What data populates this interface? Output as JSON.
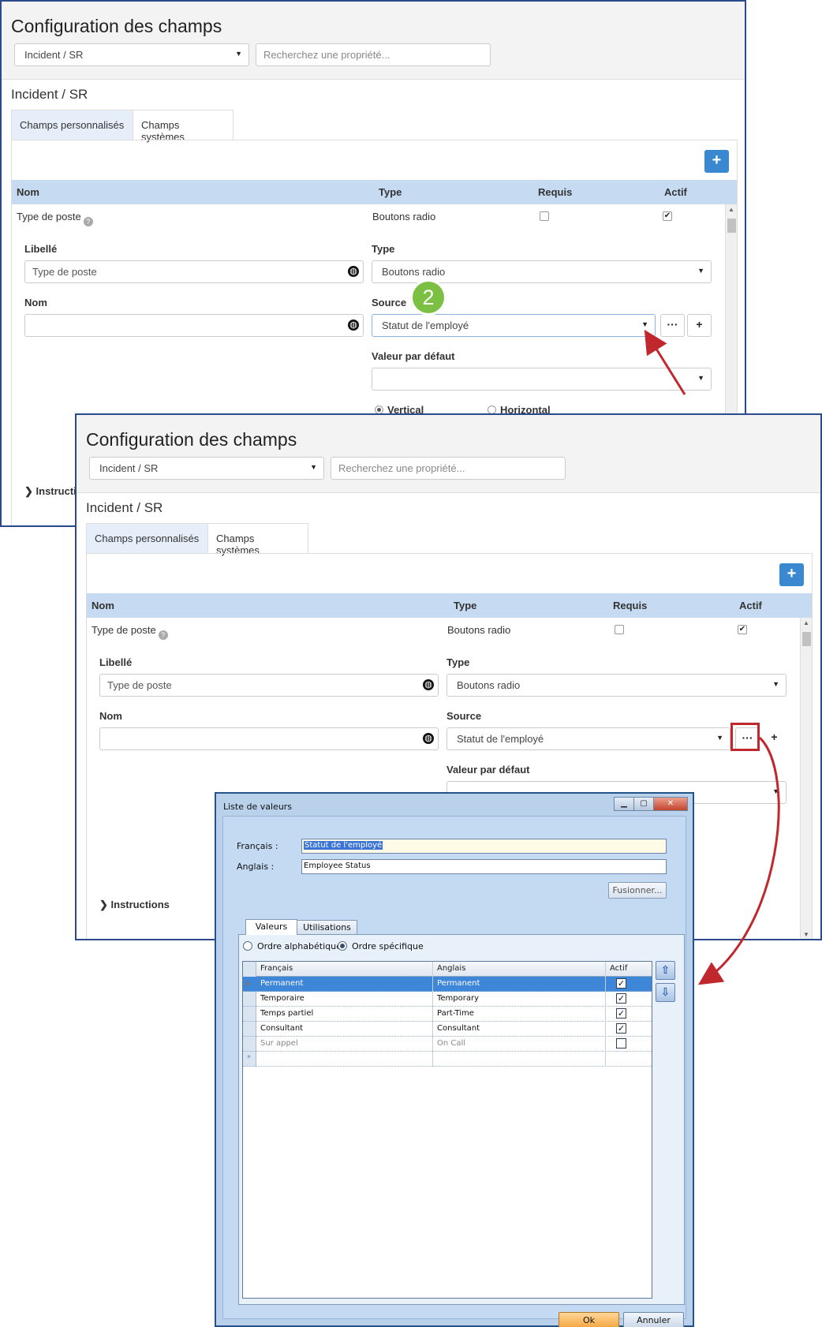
{
  "panel": {
    "title": "Configuration des champs",
    "module_select": "Incident / SR",
    "search_placeholder": "Recherchez une propriété...",
    "subtitle": "Incident / SR",
    "tabs": [
      "Champs personnalisés",
      "Champs systèmes"
    ],
    "add_button": "+",
    "columns": {
      "name": "Nom",
      "type": "Type",
      "required": "Requis",
      "active": "Actif"
    },
    "row": {
      "name": "Type de poste",
      "type": "Boutons radio",
      "required": false,
      "active": true
    },
    "form": {
      "label_title": "Libellé",
      "label_value": "Type de poste",
      "type_title": "Type",
      "type_value": "Boutons radio",
      "name_title": "Nom",
      "name_value": "",
      "source_title": "Source",
      "source_value": "Statut de l'employé",
      "ellipsis_button": "···",
      "plus_button": "+",
      "default_title": "Valeur par défaut",
      "default_value": "",
      "orientation_vertical": "Vertical",
      "orientation_horizontal": "Horizontal"
    },
    "instructions": "Instructions",
    "instructions_partial": "Instructi",
    "step_badge": "2"
  },
  "dialog": {
    "title": "Liste de valeurs",
    "french_label": "Français :",
    "french_value": "Statut de l'employé",
    "english_label": "Anglais :",
    "english_value": "Employee Status",
    "merge_button": "Fusionner...",
    "tabs": [
      "Valeurs",
      "Utilisations"
    ],
    "order_alpha": "Ordre alphabétique",
    "order_specific": "Ordre spécifique",
    "grid_columns": [
      "Français",
      "Anglais",
      "Actif"
    ],
    "rows": [
      {
        "fr": "Permanent",
        "en": "Permanent",
        "active": true
      },
      {
        "fr": "Temporaire",
        "en": "Temporary",
        "active": true
      },
      {
        "fr": "Temps partiel",
        "en": "Part-Time",
        "active": true
      },
      {
        "fr": "Consultant",
        "en": "Consultant",
        "active": true
      },
      {
        "fr": "Sur appel",
        "en": "On Call",
        "active": false
      }
    ],
    "new_row_marker": "*",
    "ok_button": "Ok",
    "cancel_button": "Annuler"
  },
  "colors": {
    "panel_border": "#2b4a8c",
    "accent_blue": "#3a88cf",
    "table_header": "#c6daf2",
    "badge_green": "#7bc043",
    "callout_red": "#c0282d",
    "grid_selection": "#3e86d8",
    "ok_orange": "#f4a43a"
  }
}
